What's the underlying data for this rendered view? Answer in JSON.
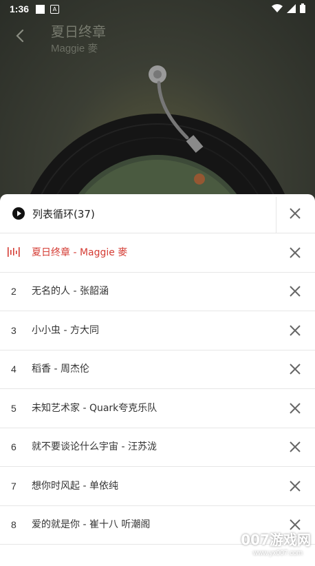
{
  "status_bar": {
    "time": "1:36"
  },
  "player": {
    "title": "夏日终章",
    "artist": "Maggie 麥"
  },
  "playlist": {
    "mode_label": "列表循环(37)",
    "items": [
      {
        "num": "",
        "text": "夏日终章 - Maggie 麥",
        "active": true
      },
      {
        "num": "2",
        "text": "无名的人 - 张韶涵"
      },
      {
        "num": "3",
        "text": "小小虫 - 方大同"
      },
      {
        "num": "4",
        "text": "稻香 - 周杰伦"
      },
      {
        "num": "5",
        "text": "未知艺术家 - Quark夸克乐队"
      },
      {
        "num": "6",
        "text": "就不要谈论什么宇宙 - 汪苏泷"
      },
      {
        "num": "7",
        "text": "想你时风起 - 单依纯"
      },
      {
        "num": "8",
        "text": "爱的就是你 - 崔十八 听潮阁"
      }
    ]
  },
  "watermark": {
    "brand": "007游戏网",
    "url": "www.yx007.com"
  },
  "colors": {
    "accent": "#d43b33"
  }
}
